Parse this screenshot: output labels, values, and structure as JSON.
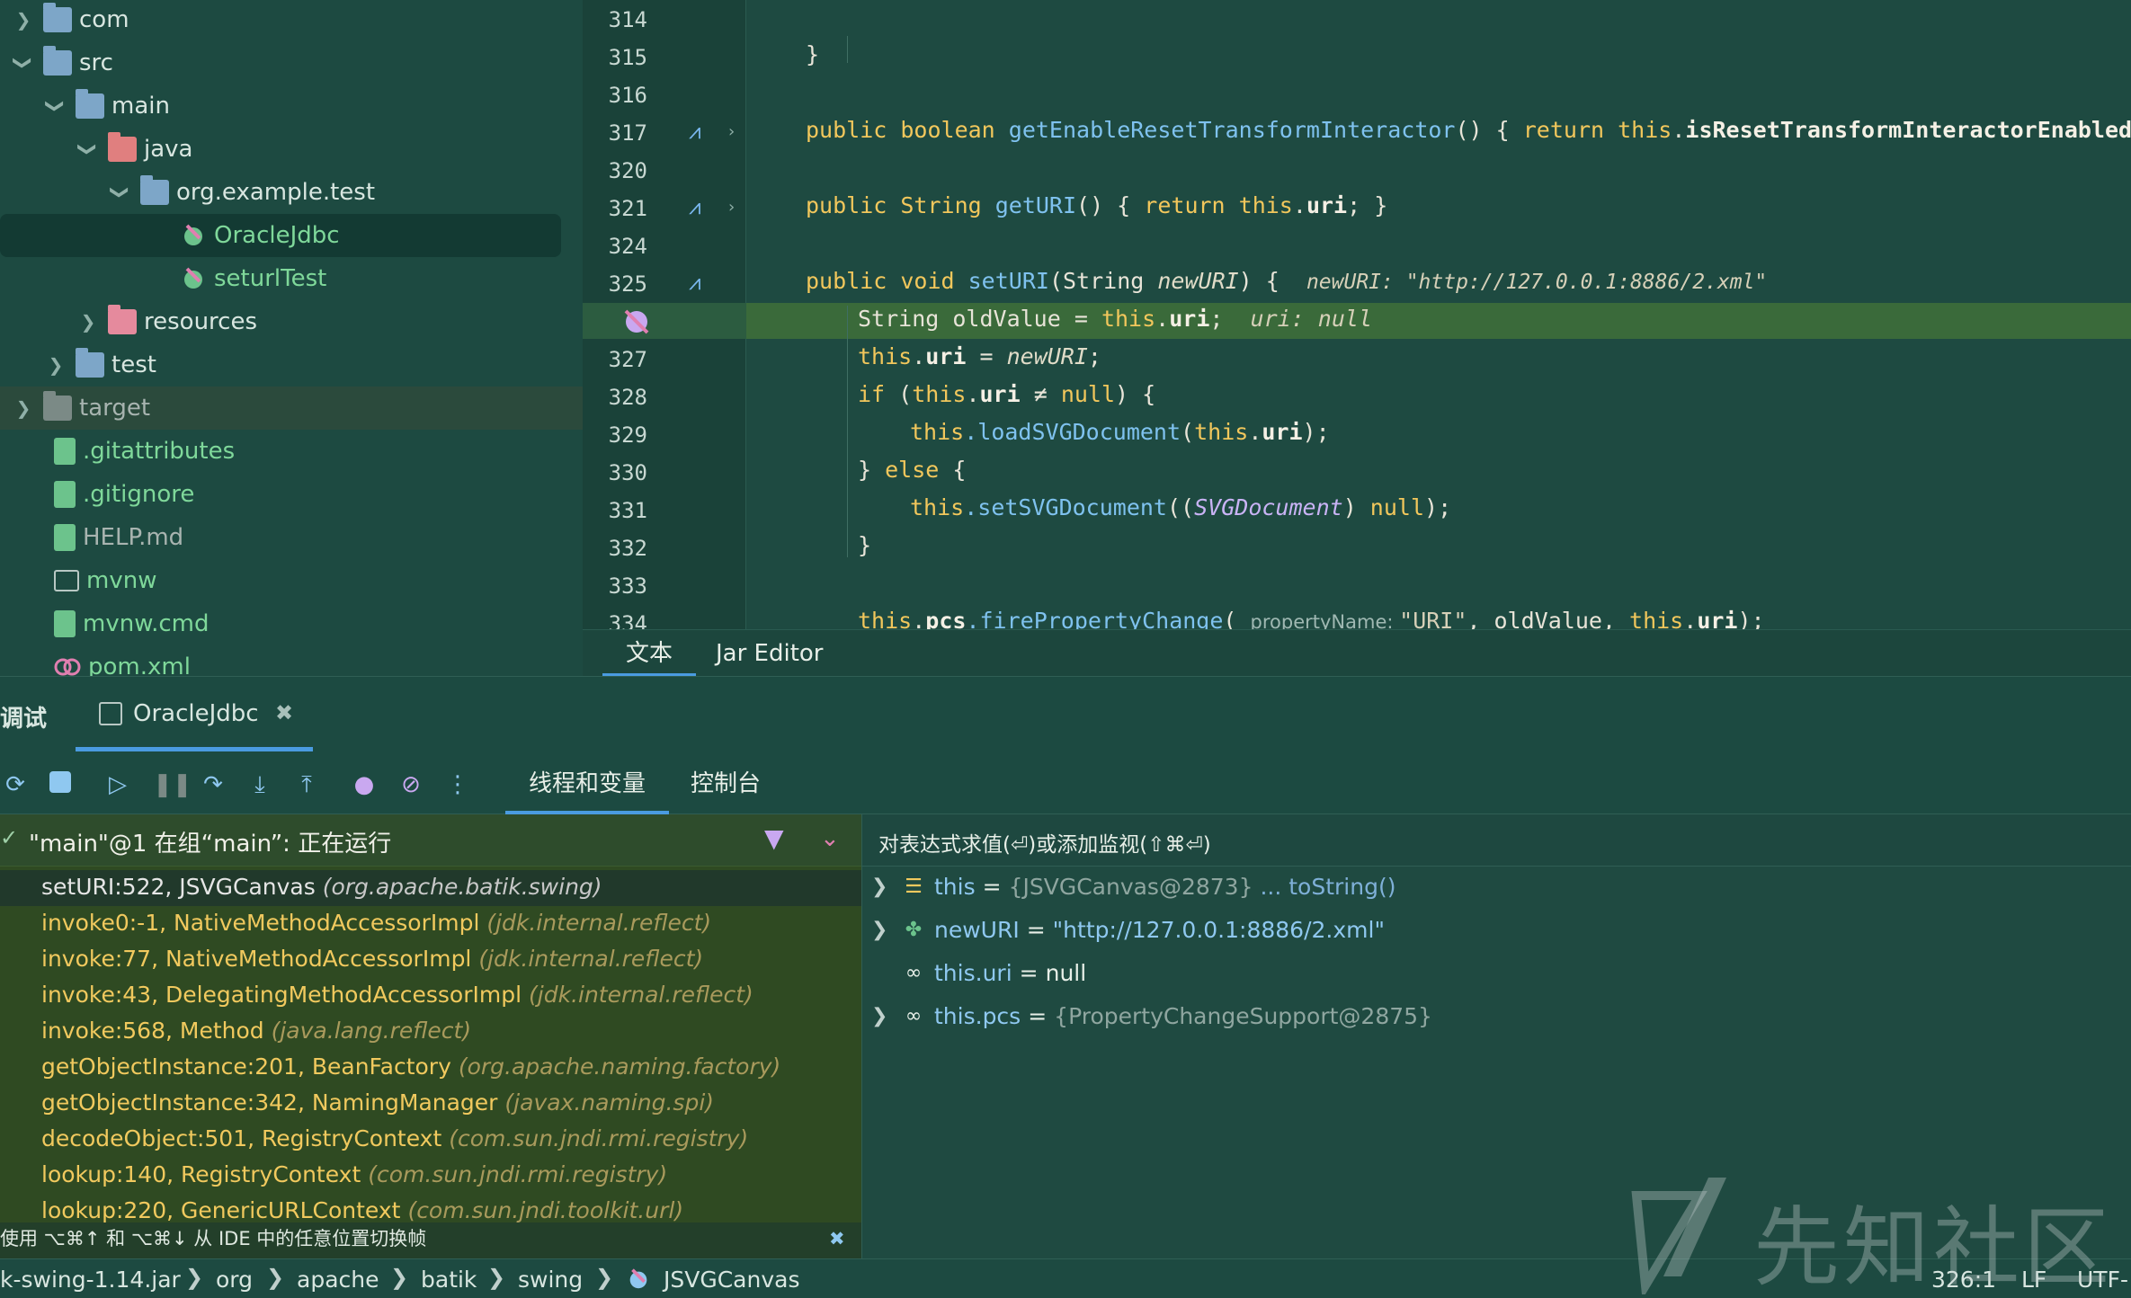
{
  "project_tree": {
    "items": [
      {
        "label": "com",
        "expanded": false,
        "icon": "folder-icon"
      },
      {
        "label": "src",
        "expanded": true,
        "icon": "folder-icon"
      },
      {
        "label": "main",
        "expanded": true,
        "icon": "folder-icon"
      },
      {
        "label": "java",
        "expanded": true,
        "icon": "source-folder-icon"
      },
      {
        "label": "org.example.test",
        "expanded": true,
        "icon": "package-icon"
      },
      {
        "label": "OracleJdbc",
        "icon": "java-class-icon",
        "selected": true
      },
      {
        "label": "seturlTest",
        "icon": "java-class-icon"
      },
      {
        "label": "resources",
        "expanded": false,
        "icon": "resources-folder-icon"
      },
      {
        "label": "test",
        "expanded": false,
        "icon": "folder-icon"
      },
      {
        "label": "target",
        "expanded": false,
        "icon": "excluded-folder-icon"
      },
      {
        "label": ".gitattributes",
        "icon": "text-file-icon"
      },
      {
        "label": ".gitignore",
        "icon": "gitignore-file-icon"
      },
      {
        "label": "HELP.md",
        "icon": "markdown-file-icon"
      },
      {
        "label": "mvnw",
        "icon": "terminal-file-icon"
      },
      {
        "label": "mvnw.cmd",
        "icon": "text-file-icon"
      },
      {
        "label": "pom.xml",
        "icon": "maven-file-icon"
      }
    ]
  },
  "editor": {
    "line_numbers": [
      "314",
      "315",
      "316",
      "317",
      "320",
      "321",
      "324",
      "325",
      "",
      "327",
      "328",
      "329",
      "330",
      "331",
      "332",
      "333",
      "334"
    ],
    "current_line": "326:1",
    "tabs": [
      "文本",
      "Jar Editor"
    ],
    "active_tab": "文本",
    "code": {
      "l315": "}",
      "l317_kw": "public boolean ",
      "l317_fn": "getEnableResetTransformInteractor",
      "l317_rest1": "() { ",
      "l317_ret": "return ",
      "l317_this": "this",
      "l317_dot": ".",
      "l317_field": "isResetTransformInteractorEnabled",
      "l317_end": "; }",
      "l321_kw": "public ",
      "l321_type": "String ",
      "l321_fn": "getURI",
      "l321_rest": "() { ",
      "l321_ret": "return ",
      "l321_this": "this",
      "l321_dot": ".",
      "l321_field": "uri",
      "l321_end": "; }",
      "l325_kw": "public void ",
      "l325_fn": "setURI",
      "l325_open": "(String ",
      "l325_param": "newURI",
      "l325_close": ") {  ",
      "l325_hint": "newURI: \"http://127.0.0.1:8886/2.xml\"",
      "l326_a": "String oldValue = ",
      "l326_this": "this",
      "l326_dot": ".",
      "l326_field": "uri",
      "l326_semi": ";  ",
      "l326_hint": "uri: null",
      "l327_this": "this",
      "l327_dot": ".",
      "l327_field": "uri",
      "l327_eq": " = ",
      "l327_param": "newURI",
      "l327_semi": ";",
      "l328_kw": "if ",
      "l328_open": "(",
      "l328_this": "this",
      "l328_dot": ".",
      "l328_field": "uri",
      "l328_op": " ≠ ",
      "l328_null": "null",
      "l328_close": ") {",
      "l329_this": "this",
      "l329_fn": ".loadSVGDocument",
      "l329_open": "(",
      "l329_this2": "this",
      "l329_dot": ".",
      "l329_field": "uri",
      "l329_close": ");",
      "l330_a": "} ",
      "l330_kw": "else",
      "l330_b": " {",
      "l331_this": "this",
      "l331_fn": ".setSVGDocument",
      "l331_open": "((",
      "l331_cls": "SVGDocument",
      "l331_mid": ") ",
      "l331_null": "null",
      "l331_close": ");",
      "l332": "}",
      "l334_this": "this",
      "l334_dot": ".",
      "l334_field": "pcs",
      "l334_fn": ".firePropertyChange",
      "l334_open": "( ",
      "l334_hint": "propertyName: ",
      "l334_str": "\"URI\"",
      "l334_rest": ", oldValue, ",
      "l334_this2": "this",
      "l334_dot2": ".",
      "l334_field2": "uri",
      "l334_end": ");"
    }
  },
  "debug": {
    "title": "调试",
    "config_tab": "OracleJdbc",
    "subtabs": [
      "线程和变量",
      "控制台"
    ],
    "active_subtab": "线程和变量",
    "thread_status": "\"main\"@1 在组“main”: 正在运行",
    "frames": [
      {
        "method": "setURI:522, JSVGCanvas",
        "pkg": "(org.apache.batik.swing)"
      },
      {
        "method": "invoke0:-1, NativeMethodAccessorImpl",
        "pkg": "(jdk.internal.reflect)"
      },
      {
        "method": "invoke:77, NativeMethodAccessorImpl",
        "pkg": "(jdk.internal.reflect)"
      },
      {
        "method": "invoke:43, DelegatingMethodAccessorImpl",
        "pkg": "(jdk.internal.reflect)"
      },
      {
        "method": "invoke:568, Method",
        "pkg": "(java.lang.reflect)"
      },
      {
        "method": "getObjectInstance:201, BeanFactory",
        "pkg": "(org.apache.naming.factory)"
      },
      {
        "method": "getObjectInstance:342, NamingManager",
        "pkg": "(javax.naming.spi)"
      },
      {
        "method": "decodeObject:501, RegistryContext",
        "pkg": "(com.sun.jndi.rmi.registry)"
      },
      {
        "method": "lookup:140, RegistryContext",
        "pkg": "(com.sun.jndi.rmi.registry)"
      },
      {
        "method": "lookup:220, GenericURLContext",
        "pkg": "(com.sun.jndi.toolkit.url)"
      }
    ],
    "eval_placeholder": "对表达式求值(⏎)或添加监视(⇧⌘⏎)",
    "variables": [
      {
        "name": "this",
        "eq": "=",
        "value": "{JSVGCanvas@2873}",
        "extra": "... toString()",
        "expandable": true,
        "icon": "field-icon"
      },
      {
        "name": "newURI",
        "eq": "=",
        "value": "\"http://127.0.0.1:8886/2.xml\"",
        "expandable": true,
        "icon": "parameter-icon"
      },
      {
        "name": "this.uri",
        "eq": "=",
        "value": "null",
        "expandable": false,
        "icon": "watch-icon"
      },
      {
        "name": "this.pcs",
        "eq": "=",
        "value": "{PropertyChangeSupport@2875}",
        "expandable": true,
        "icon": "watch-icon"
      }
    ],
    "tip": "使用 ⌥⌘↑ 和 ⌥⌘↓ 从 IDE 中的任意位置切换帧"
  },
  "statusbar": {
    "breadcrumbs": [
      "k-swing-1.14.jar",
      "org",
      "apache",
      "batik",
      "swing",
      "JSVGCanvas"
    ],
    "position": "326:1",
    "line_sep": "LF",
    "encoding": "UTF-"
  },
  "watermark": {
    "text": "先知社区"
  },
  "colors": {
    "accent": "#4a9be0",
    "keyword": "#f2c75c",
    "method": "#7fc2ef",
    "frame_text": "#f1c95e"
  }
}
